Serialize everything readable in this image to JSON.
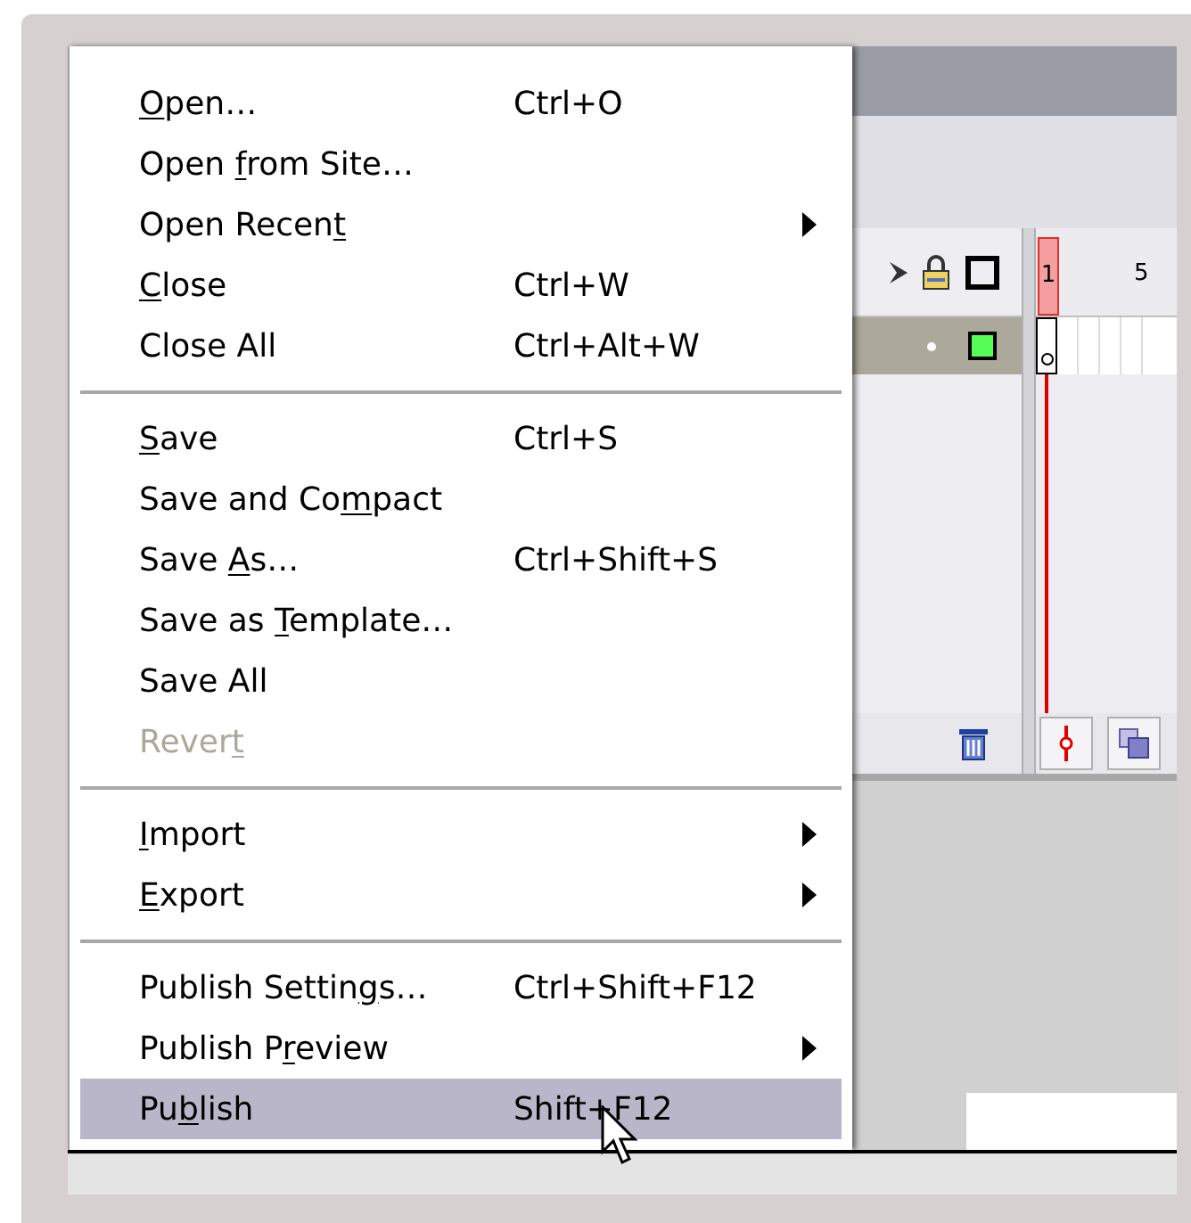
{
  "menu": {
    "items": [
      {
        "kind": "item",
        "parts": {
          "key": "O",
          "after": "pen…"
        },
        "shortcut": "Ctrl+O",
        "submenu": false,
        "disabled": false,
        "selected": false
      },
      {
        "kind": "item",
        "parts": {
          "before": "Open ",
          "key": "f",
          "after": "rom Site…"
        },
        "submenu": false,
        "disabled": false,
        "selected": false
      },
      {
        "kind": "item",
        "parts": {
          "before": "Open Recen",
          "key": "t"
        },
        "submenu": true,
        "disabled": false,
        "selected": false
      },
      {
        "kind": "item",
        "parts": {
          "key": "C",
          "after": "lose"
        },
        "shortcut": "Ctrl+W",
        "submenu": false,
        "disabled": false,
        "selected": false
      },
      {
        "kind": "item",
        "parts": {
          "before": "Close All"
        },
        "shortcut": "Ctrl+Alt+W",
        "submenu": false,
        "disabled": false,
        "selected": false
      },
      {
        "kind": "separator"
      },
      {
        "kind": "item",
        "parts": {
          "key": "S",
          "after": "ave"
        },
        "shortcut": "Ctrl+S",
        "submenu": false,
        "disabled": false,
        "selected": false
      },
      {
        "kind": "item",
        "parts": {
          "before": "Save and Co",
          "key": "m",
          "after": "pact"
        },
        "submenu": false,
        "disabled": false,
        "selected": false
      },
      {
        "kind": "item",
        "parts": {
          "before": "Save ",
          "key": "A",
          "after": "s…"
        },
        "shortcut": "Ctrl+Shift+S",
        "submenu": false,
        "disabled": false,
        "selected": false
      },
      {
        "kind": "item",
        "parts": {
          "before": "Save as ",
          "key": "T",
          "after": "emplate…"
        },
        "submenu": false,
        "disabled": false,
        "selected": false
      },
      {
        "kind": "item",
        "parts": {
          "before": "Save All"
        },
        "submenu": false,
        "disabled": false,
        "selected": false
      },
      {
        "kind": "item",
        "parts": {
          "before": "Rever",
          "key": "t"
        },
        "submenu": false,
        "disabled": true,
        "selected": false
      },
      {
        "kind": "separator"
      },
      {
        "kind": "item",
        "parts": {
          "key": "I",
          "after": "mport"
        },
        "submenu": true,
        "disabled": false,
        "selected": false
      },
      {
        "kind": "item",
        "parts": {
          "key": "E",
          "after": "xport"
        },
        "submenu": true,
        "disabled": false,
        "selected": false
      },
      {
        "kind": "separator"
      },
      {
        "kind": "item",
        "parts": {
          "before": "Publish Settin",
          "key": "g",
          "after": "s…"
        },
        "shortcut": "Ctrl+Shift+F12",
        "submenu": false,
        "disabled": false,
        "selected": false
      },
      {
        "kind": "item",
        "parts": {
          "before": "Publish P",
          "key": "r",
          "after": "eview"
        },
        "submenu": true,
        "disabled": false,
        "selected": false
      },
      {
        "kind": "item",
        "parts": {
          "before": "Pu",
          "key": "b",
          "after": "lish"
        },
        "shortcut": "Shift+F12",
        "submenu": false,
        "disabled": false,
        "selected": true
      }
    ]
  },
  "timeline": {
    "frame_labels": [
      "1",
      "5"
    ]
  }
}
